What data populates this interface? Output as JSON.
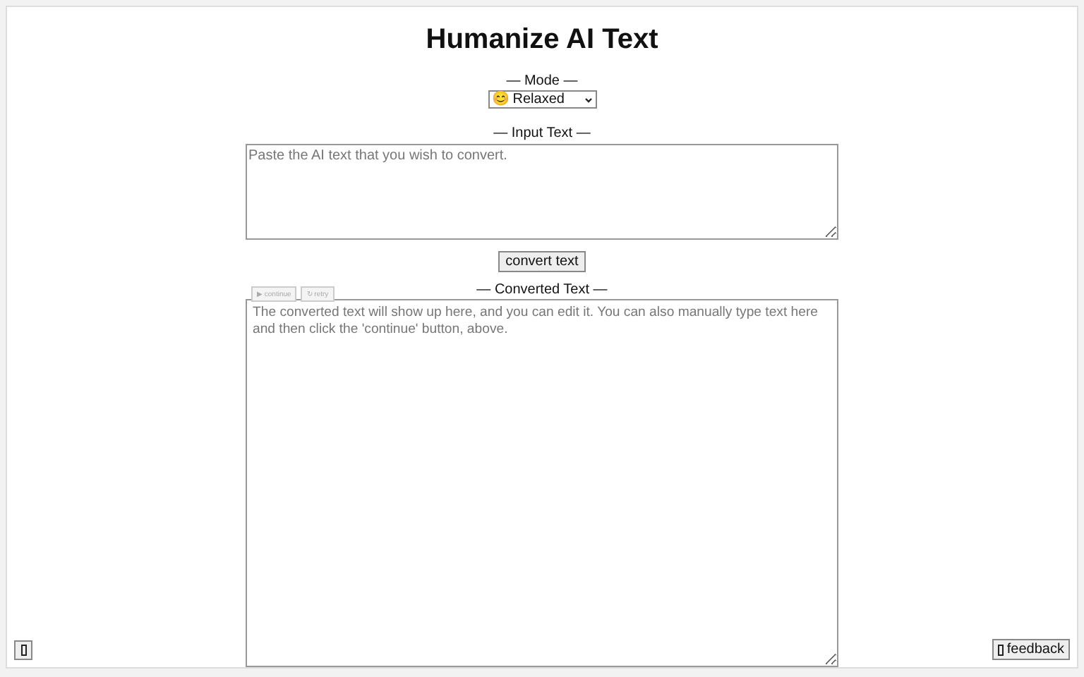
{
  "title": "Humanize AI Text",
  "mode": {
    "label": "— Mode —",
    "value": "😊 Relaxed"
  },
  "input": {
    "label": "— Input Text —",
    "placeholder": "Paste the AI text that you wish to convert."
  },
  "convert_button": "convert text",
  "output": {
    "label": "— Converted Text —",
    "placeholder": "The converted text will show up here, and you can edit it. You can also manually type text here and then click the 'continue' button, above.",
    "actions": [
      {
        "label": "▶ continue",
        "disabled": true
      },
      {
        "label": "↻ retry",
        "disabled": true
      }
    ]
  },
  "feedback_button": "feedback"
}
